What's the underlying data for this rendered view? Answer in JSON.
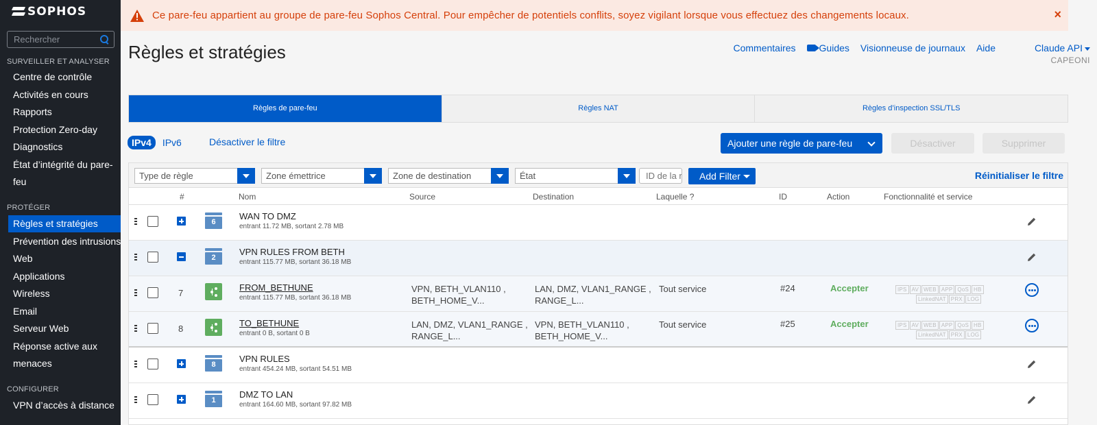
{
  "brand": {
    "name": "SOPHOS"
  },
  "sidebar": {
    "search_placeholder": "Rechercher",
    "sections": [
      {
        "title": "SURVEILLER ET ANALYSER"
      },
      {
        "title": "PROTÉGER"
      },
      {
        "title": "CONFIGURER"
      }
    ],
    "items": [
      {
        "label": "Centre de contrôle"
      },
      {
        "label": "Activités en cours"
      },
      {
        "label": "Rapports"
      },
      {
        "label": "Protection Zero-day"
      },
      {
        "label": "Diagnostics"
      },
      {
        "label": "État d’intégrité du pare-feu"
      },
      {
        "label": "Règles et stratégies",
        "active": true
      },
      {
        "label": "Prévention des intrusions"
      },
      {
        "label": "Web"
      },
      {
        "label": "Applications"
      },
      {
        "label": "Wireless"
      },
      {
        "label": "Email"
      },
      {
        "label": "Serveur Web"
      },
      {
        "label": "Réponse active aux menaces"
      },
      {
        "label": "VPN d’accès à distance"
      }
    ]
  },
  "banner": {
    "text": "Ce pare-feu appartient au groupe de pare-feu Sophos Central. Pour empêcher de potentiels conflits, soyez vigilant lorsque vous effectuez des changements locaux.",
    "close": "×",
    "color": "#d5400b"
  },
  "header": {
    "title": "Règles et stratégies",
    "links": {
      "comments": "Commentaires",
      "guides": "Guides",
      "log_viewer": "Visionneuse de journaux",
      "help": "Aide"
    },
    "user": "Claude API",
    "org": "CAPEONI"
  },
  "tabs": [
    {
      "label": "Règles de pare-feu",
      "active": true
    },
    {
      "label": "Règles NAT"
    },
    {
      "label": "Règles d’inspection SSL/TLS"
    }
  ],
  "toolbar": {
    "ipv4": "IPv4",
    "ipv6": "IPv6",
    "clear_filter": "Désactiver le filtre",
    "add_rule": "Ajouter une règle de pare-feu",
    "disable": "Désactiver",
    "delete": "Supprimer"
  },
  "filters": {
    "rule_type": "Type de règle",
    "source_zone": "Zone émettrice",
    "dest_zone": "Zone de destination",
    "state": "État",
    "id_placeholder": "ID de la règle",
    "add_filter": "Add Filter",
    "reset": "Réinitialiser le filtre"
  },
  "table": {
    "columns": {
      "num": "#",
      "name": "Nom",
      "source": "Source",
      "destination": "Destination",
      "which": "Laquelle ?",
      "id": "ID",
      "action": "Action",
      "features": "Fonctionnalité et service"
    },
    "rows": [
      {
        "kind": "group",
        "expanded": false,
        "count": "6",
        "name": "WAN TO DMZ",
        "traffic": "entrant 11.72 MB, sortant 2.78 MB"
      },
      {
        "kind": "group",
        "expanded": true,
        "count": "2",
        "name": "VPN RULES FROM BETH",
        "traffic": "entrant 115.77 MB, sortant 36.18 MB"
      },
      {
        "kind": "rule",
        "num": "7",
        "name": "FROM_BETHUNE",
        "traffic": "entrant 115.77 MB, sortant 36.18 MB",
        "source": "VPN, BETH_VLAN110 ,",
        "source2": "BETH_HOME_V...",
        "destination": "LAN, DMZ, VLAN1_RANGE ,",
        "destination2": "RANGE_L...",
        "which": "Tout service",
        "id": "#24",
        "action": "Accepter"
      },
      {
        "kind": "rule",
        "num": "8",
        "name": "TO_BETHUNE",
        "traffic": "entrant 0 B, sortant 0 B",
        "source": "LAN, DMZ, VLAN1_RANGE ,",
        "source2": "RANGE_L...",
        "destination": "VPN, BETH_VLAN110 ,",
        "destination2": "BETH_HOME_V...",
        "which": "Tout service",
        "id": "#25",
        "action": "Accepter"
      },
      {
        "kind": "group",
        "expanded": false,
        "count": "8",
        "name": "VPN RULES",
        "traffic": "entrant 454.24 MB, sortant 54.51 MB"
      },
      {
        "kind": "group",
        "expanded": false,
        "count": "1",
        "name": "DMZ TO LAN",
        "traffic": "entrant 164.60 MB, sortant 97.82 MB"
      }
    ],
    "feature_tags": [
      "IPS",
      "AV",
      "WEB",
      "APP",
      "QoS",
      "HB",
      "LinkedNAT",
      "PRX",
      "LOG"
    ]
  }
}
